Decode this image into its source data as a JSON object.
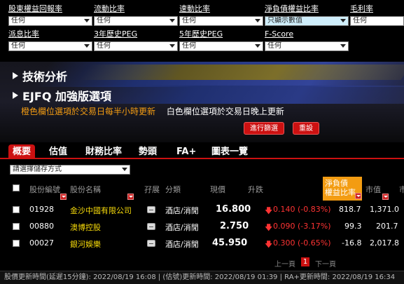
{
  "filters": [
    {
      "label": "股東權益回報率",
      "value": "任何"
    },
    {
      "label": "流動比率",
      "value": "任何"
    },
    {
      "label": "速動比率",
      "value": "任何"
    },
    {
      "label": "淨負債權益比率",
      "value": "只顯示數值"
    },
    {
      "label": "毛利率",
      "value": "任何"
    },
    {
      "label": "派息比率",
      "value": "任何"
    },
    {
      "label": "3年歷史PEG",
      "value": "任何"
    },
    {
      "label": "5年歷史PEG",
      "value": "任何"
    },
    {
      "label": "F-Score",
      "value": "任何"
    }
  ],
  "sections": {
    "technical": "技術分析",
    "ejfq": "EJFQ 加強版選項"
  },
  "notes": {
    "orange": "橙色欄位選項於交易日每半小時更新",
    "white": "白色欄位選項於交易日晚上更新"
  },
  "buttons": {
    "run": "進行篩選",
    "reset": "重設"
  },
  "tabs": [
    "概要",
    "估值",
    "財務比率",
    "勢頭",
    "FA+",
    "圖表一覽"
  ],
  "sort_select": "請選擇儲存方式",
  "table": {
    "headers": {
      "code": "股份編號",
      "name": "股份名稱",
      "margin": "孖展",
      "category": "分類",
      "price": "現價",
      "change": "升跌",
      "de_ratio_1": "淨負債",
      "de_ratio_2": "權益比率",
      "market_cap": "市值",
      "more": "市"
    },
    "rows": [
      {
        "code": "01928",
        "name": "金沙中國有限公司",
        "category": "酒店/消閒",
        "price": "16.800",
        "change": "0.140 (-0.83%)",
        "de": "818.7",
        "cap": "1,371.0"
      },
      {
        "code": "00880",
        "name": "澳博控股",
        "category": "酒店/消閒",
        "price": "2.750",
        "change": "0.090 (-3.17%)",
        "de": "99.3",
        "cap": "201.7"
      },
      {
        "code": "00027",
        "name": "銀河娛樂",
        "category": "酒店/消閒",
        "price": "45.950",
        "change": "0.300 (-0.65%)",
        "de": "-16.8",
        "cap": "2,017.8"
      }
    ]
  },
  "pager": {
    "prev": "上一頁",
    "page": "1",
    "next": "下一頁"
  },
  "footer": "股價更新時間(延遲15分鐘): 2022/08/19 16:08  |  (估號)更新時間: 2022/08/19 01:39  |  RA+更新時間: 2022/08/19 16:34"
}
